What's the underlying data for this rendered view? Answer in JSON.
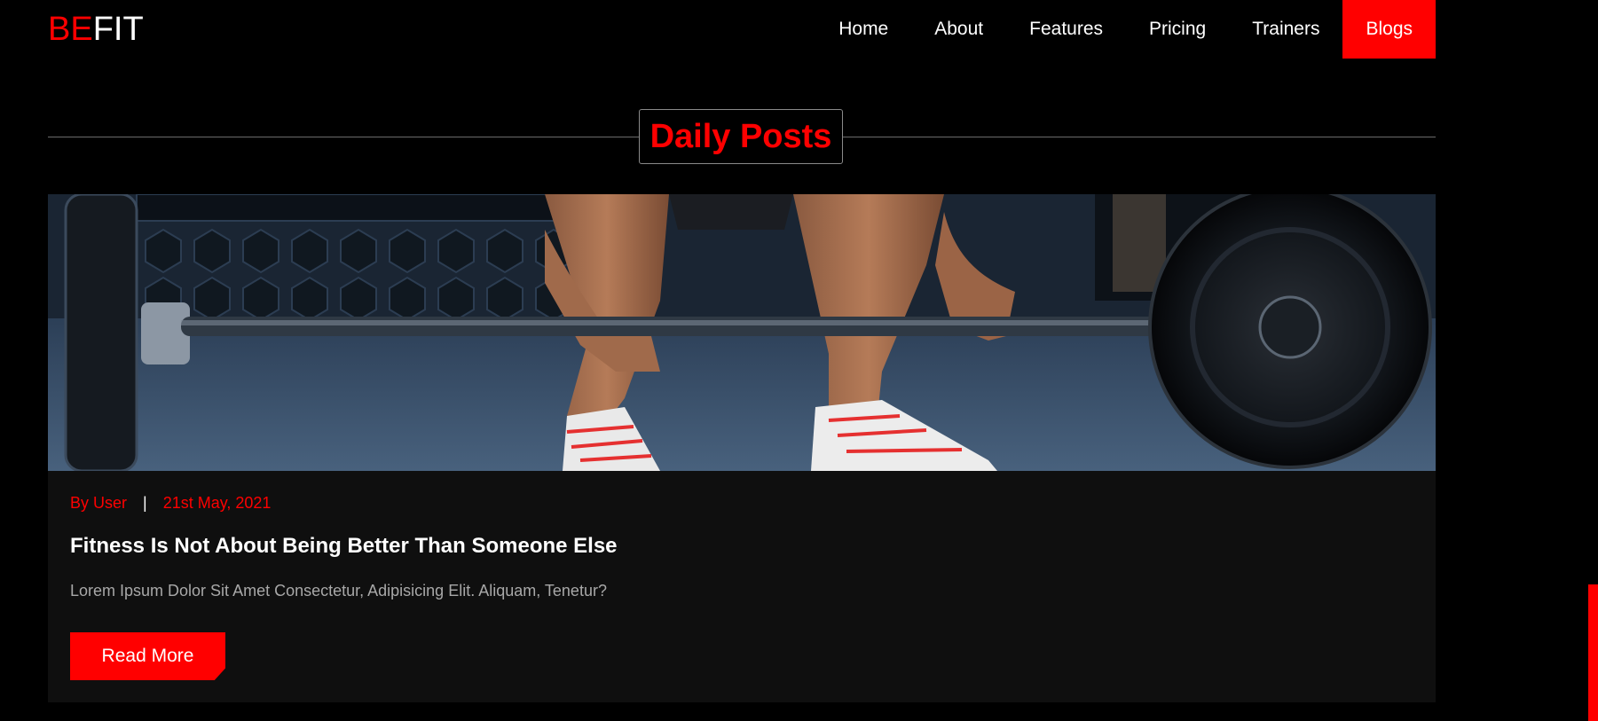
{
  "brand": {
    "logo_part1": "BE",
    "logo_part2": "FIT",
    "accent_color": "#ff0000"
  },
  "nav": {
    "items": [
      {
        "label": "Home"
      },
      {
        "label": "About"
      },
      {
        "label": "Features"
      },
      {
        "label": "Pricing"
      },
      {
        "label": "Trainers"
      },
      {
        "label": "Blogs",
        "active": true
      }
    ]
  },
  "section": {
    "title": "Daily Posts"
  },
  "post": {
    "author": "By User",
    "separator": "|",
    "date": "21st May, 2021",
    "title": "Fitness Is Not About Being Better Than Someone Else",
    "excerpt": "Lorem Ipsum Dolor Sit Amet Consectetur, Adipisicing Elit. Aliquam, Tenetur?",
    "read_more_label": "Read More"
  }
}
